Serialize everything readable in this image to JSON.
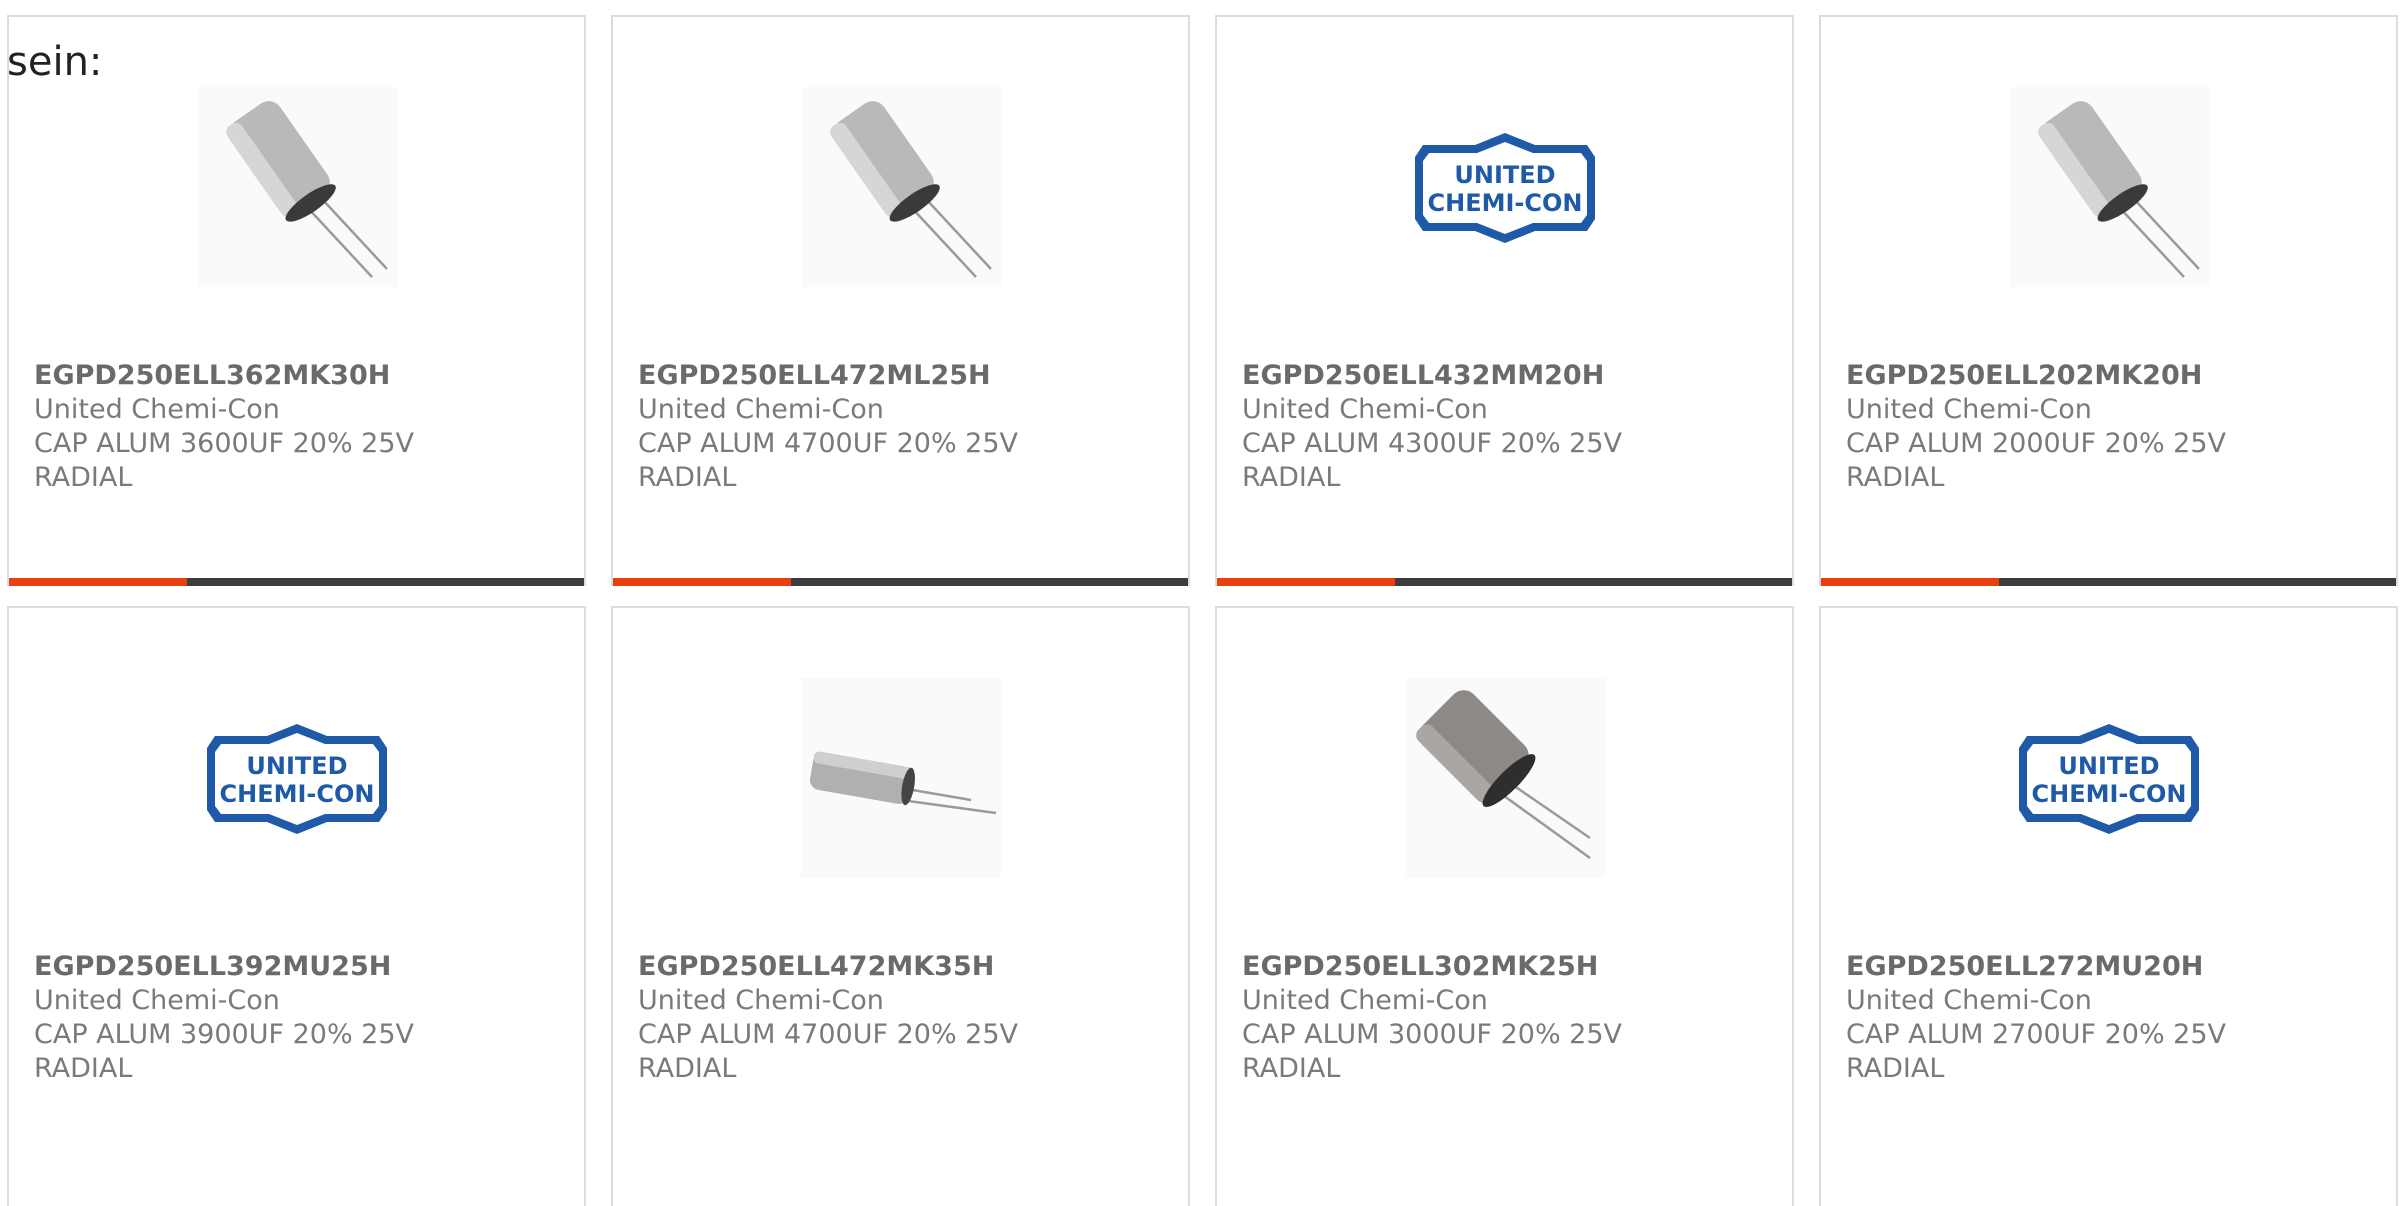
{
  "intro_text": "sein:",
  "colors": {
    "accent": "#e8410f",
    "bar": "#3d3d3d",
    "logo_blue": "#1f5aa8",
    "text": "#7a7a7a"
  },
  "products": [
    {
      "part_number": "EGPD250ELL362MK30H",
      "manufacturer": "United Chemi-Con",
      "description": "CAP ALUM 3600UF 20% 25V",
      "package": "RADIAL",
      "image": "capacitor-upright-icon",
      "progress": 0.31
    },
    {
      "part_number": "EGPD250ELL472ML25H",
      "manufacturer": "United Chemi-Con",
      "description": "CAP ALUM 4700UF 20% 25V",
      "package": "RADIAL",
      "image": "capacitor-upright-icon",
      "progress": 0.31
    },
    {
      "part_number": "EGPD250ELL432MM20H",
      "manufacturer": "United Chemi-Con",
      "description": "CAP ALUM 4300UF 20% 25V",
      "package": "RADIAL",
      "image": "united-chemi-con-logo",
      "progress": 0.31
    },
    {
      "part_number": "EGPD250ELL202MK20H",
      "manufacturer": "United Chemi-Con",
      "description": "CAP ALUM 2000UF 20% 25V",
      "package": "RADIAL",
      "image": "capacitor-upright-icon",
      "progress": 0.31
    },
    {
      "part_number": "EGPD250ELL392MU25H",
      "manufacturer": "United Chemi-Con",
      "description": "CAP ALUM 3900UF 20% 25V",
      "package": "RADIAL",
      "image": "united-chemi-con-logo"
    },
    {
      "part_number": "EGPD250ELL472MK35H",
      "manufacturer": "United Chemi-Con",
      "description": "CAP ALUM 4700UF 20% 25V",
      "package": "RADIAL",
      "image": "capacitor-lying-icon"
    },
    {
      "part_number": "EGPD250ELL302MK25H",
      "manufacturer": "United Chemi-Con",
      "description": "CAP ALUM 3000UF 20% 25V",
      "package": "RADIAL",
      "image": "capacitor-dark-icon"
    },
    {
      "part_number": "EGPD250ELL272MU20H",
      "manufacturer": "United Chemi-Con",
      "description": "CAP ALUM 2700UF 20% 25V",
      "package": "RADIAL",
      "image": "united-chemi-con-logo"
    }
  ],
  "logo": {
    "line1": "UNITED",
    "line2": "CHEMI-CON"
  }
}
